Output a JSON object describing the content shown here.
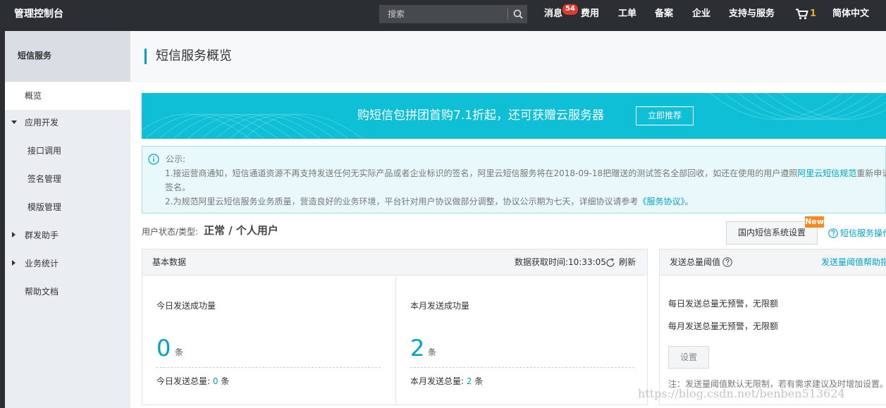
{
  "topbar": {
    "brand": "管理控制台",
    "search_placeholder": "搜索",
    "nav": {
      "messages": "消息",
      "messages_badge": "54",
      "billing": "费用",
      "tickets": "工单",
      "icp": "备案",
      "enterprise": "企业",
      "support": "支持与服务",
      "cart_count": "1",
      "language": "简体中文"
    }
  },
  "sidebar": {
    "title": "短信服务",
    "items": {
      "overview": "概览",
      "app_dev": "应用开发",
      "api_call": "接口调用",
      "signature": "签名管理",
      "template": "模版管理",
      "bulk": "群发助手",
      "stats": "业务统计",
      "docs": "帮助文档"
    }
  },
  "page": {
    "title": "短信服务概览"
  },
  "banner": {
    "text": "购短信包拼团首购7.1折起，还可获赠云服务器",
    "button": "立即推荐"
  },
  "notice": {
    "title": "公示:",
    "line1_a": "1.接运营商通知，短信通道资源不再支持发送任何无实际产品或者企业标识的签名，阿里云短信服务将在2018-09-18把赠送的测试签名全部回收，如还在使用的用户遵照",
    "line1_link": "阿里云短信规范",
    "line1_b": "重新申请",
    "line1_c": "签名。",
    "line2_a": "2.为规范阿里云短信服务业务质量，营造良好的业务环境，平台针对用户协议做部分调整，协议公示期为七天，详细协议请参考",
    "line2_link": "《服务协议》",
    "line2_b": "。"
  },
  "user_status": {
    "label": "用户状态/类型:",
    "value": "正常 / 个人用户",
    "settings_button": "国内短信系统设置",
    "new_badge": "New",
    "help_link": "短信服务操作"
  },
  "basic_data": {
    "title": "基本数据",
    "fetch_time": "数据获取时间:10:33:05",
    "refresh": "刷新",
    "today": {
      "label": "今日发送成功量",
      "value": "0",
      "unit": "条",
      "total_label": "今日发送总量:",
      "total_value": "0",
      "total_unit": "条"
    },
    "month": {
      "label": "本月发送成功量",
      "value": "2",
      "unit": "条",
      "total_label": "本月发送总量:",
      "total_value": "2",
      "total_unit": "条"
    }
  },
  "threshold": {
    "title": "发送总量阈值",
    "help_link": "发送量阈值帮助指",
    "daily": "每日发送总量无预警，无限额",
    "monthly": "每月发送总量无预警，无限额",
    "button": "设置",
    "note": "注：发送量阈值默认无限制，若有需求建议及时增加设置。"
  },
  "watermark": "https://blog.csdn.net/benben513624",
  "colors": {
    "topbar": "#2b2f33",
    "accent": "#00a2ca",
    "banner": "#0ebfd6",
    "badge": "#e23a2f",
    "new_badge": "#f5891f"
  }
}
